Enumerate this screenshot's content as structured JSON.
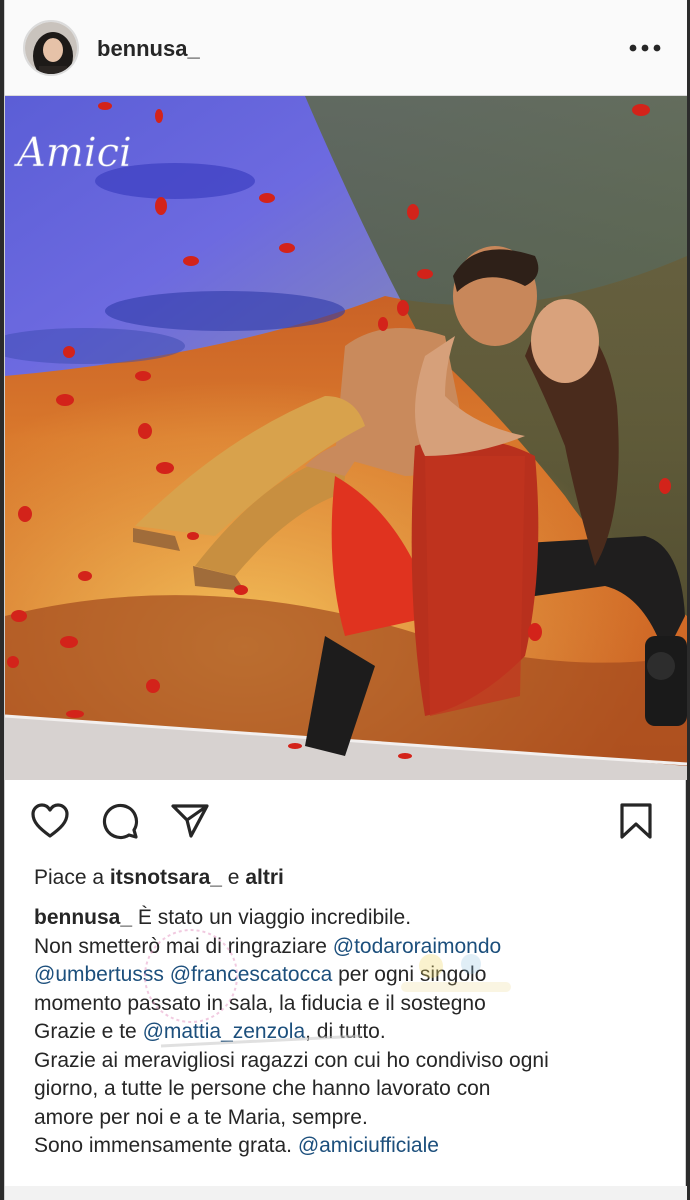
{
  "header": {
    "username": "bennusa_",
    "more_icon": "more-horizontal-icon"
  },
  "photo": {
    "logo_text": "Amici"
  },
  "actions": {
    "like_icon": "heart-icon",
    "comment_icon": "comment-icon",
    "share_icon": "paper-plane-icon",
    "save_icon": "bookmark-icon"
  },
  "likes": {
    "prefix": "Piace a",
    "user": "itsnotsara_",
    "connector": "e",
    "others": "altri"
  },
  "caption": {
    "author": "bennusa_",
    "line1": " È stato un viaggio incredibile.",
    "line2_text": "Non smetterò mai di ringraziare ",
    "mention_todaro": "@todaroraimondo",
    "mention_umbertusss": "@umbertusss",
    "mention_francescatocca": "@francescatocca",
    "line3_text": " per ogni singolo",
    "line4": "momento passato in sala, la fiducia e il sostegno",
    "line5_text": "Grazie e te ",
    "mention_mattia": "@mattia_zenzola",
    "line5_end": ", di tutto.",
    "line6": "Grazie ai meravigliosi ragazzi con cui ho condiviso ogni",
    "line7": "giorno, a tutte le persone che hanno lavorato con",
    "line8": "amore per noi e a te Maria, sempre.",
    "line9_text": "Sono immensamente grata. ",
    "mention_amici": "@amiciufficiale"
  },
  "colors": {
    "mention": "#1c4f7c",
    "text": "#262626",
    "header_bg": "#fafafa"
  }
}
